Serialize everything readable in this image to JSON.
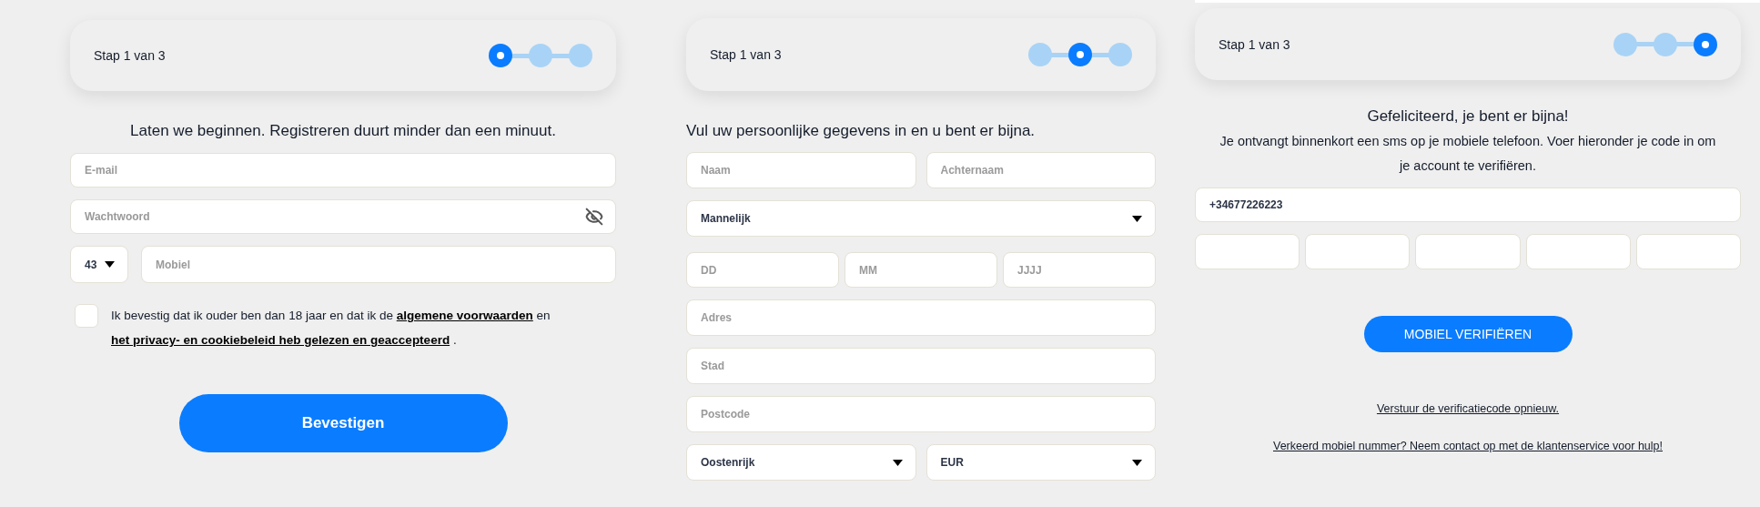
{
  "panels": [
    {
      "kind": "register",
      "step_label": "Stap 1 van 3",
      "steps": [
        {
          "selected": true
        },
        {
          "selected": false
        },
        {
          "selected": false
        }
      ],
      "heading": "Laten we beginnen. Registreren duurt minder dan een minuut.",
      "email": {
        "placeholder": "E-mail"
      },
      "password": {
        "placeholder": "Wachtwoord"
      },
      "country_code": {
        "value": "43"
      },
      "mobile": {
        "placeholder": "Mobiel"
      },
      "consent": {
        "checked": false,
        "parts": [
          {
            "kind": "text",
            "text": "Ik bevestig dat ik ouder ben dan 18 jaar en dat ik de "
          },
          {
            "kind": "link",
            "text": "algemene voorwaarden"
          },
          {
            "kind": "text",
            "text": " en "
          },
          {
            "kind": "link",
            "text": "het privacy- en cookiebeleid heb gelezen en geaccepteerd"
          },
          {
            "kind": "text",
            "text": " ."
          }
        ]
      },
      "button": "Bevestigen"
    },
    {
      "kind": "details",
      "step_label": "Stap 1 van 3",
      "steps": [
        {
          "selected": false
        },
        {
          "selected": true
        },
        {
          "selected": false
        }
      ],
      "heading": "Vul uw persoonlijke gegevens in en u bent er bijna.",
      "first_name": {
        "placeholder": "Naam"
      },
      "last_name": {
        "placeholder": "Achternaam"
      },
      "gender": {
        "value": "Mannelijk"
      },
      "birth_date": [
        {
          "placeholder": "DD"
        },
        {
          "placeholder": "MM"
        },
        {
          "placeholder": "JJJJ"
        }
      ],
      "address": {
        "placeholder": "Adres"
      },
      "city": {
        "placeholder": "Stad"
      },
      "postcode": {
        "placeholder": "Postcode"
      },
      "country": {
        "value": "Oostenrijk"
      },
      "currency": {
        "value": "EUR"
      }
    },
    {
      "kind": "verify",
      "step_label": "Stap 1 van 3",
      "steps": [
        {
          "selected": false
        },
        {
          "selected": false
        },
        {
          "selected": true
        }
      ],
      "heading": "Gefeliciteerd, je bent er bijna!",
      "message": "Je ontvangt binnenkort een sms op je mobiele telefoon. Voer hieronder je code in om je account te verifiëren.",
      "phone": {
        "value": "+34677226223"
      },
      "code_fields": [
        {
          "kind": "digit"
        },
        {
          "kind": "digit"
        },
        {
          "kind": "digit"
        },
        {
          "kind": "digit"
        },
        {
          "kind": "digit"
        }
      ],
      "button": "MOBIEL VERIFIËREN",
      "links": [
        "Verstuur de verificatiecode opnieuw.",
        "Verkeerd mobiel nummer? Neem contact op met de klantenservice voor hulp!"
      ]
    }
  ]
}
